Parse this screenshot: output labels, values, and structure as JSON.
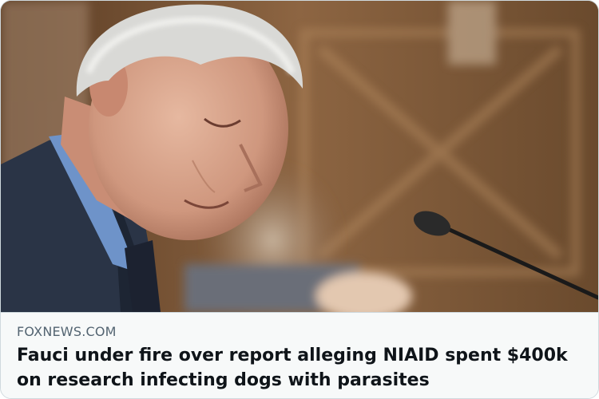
{
  "card": {
    "domain": "FOXNEWS.COM",
    "headline": "Fauci under fire over report alleging NIAID spent $400k on research infecting dogs with parasites"
  },
  "image": {
    "subject": "photo-man-at-hearing"
  },
  "colors": {
    "card_background": "#f7f9f9",
    "domain_text": "#536471",
    "headline_text": "#0f1419",
    "border": "#cfd9de"
  }
}
